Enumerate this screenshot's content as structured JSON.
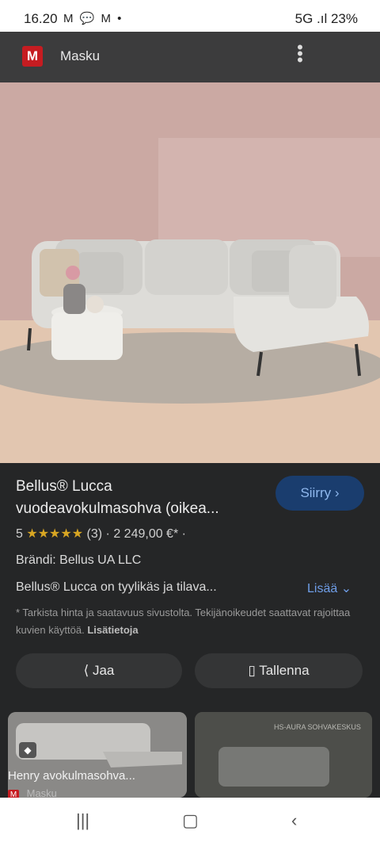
{
  "status_bar": {
    "time": "16.20",
    "left_icons": "M 💬 M •",
    "right": "5G .ıl 23%"
  },
  "app_bar": {
    "logo": "M",
    "title": "Masku"
  },
  "product": {
    "title_line1": "Bellus® Lucca",
    "title_line2": "vuodeavokulmasohva (oikea...",
    "rating_value": "5",
    "stars": "★★★★★",
    "rating_count": "(3)",
    "price": "2 249,00 €*",
    "brand": "Brändi: Bellus UA LLC",
    "description": "Bellus® Lucca on tyylikäs ja tilava...",
    "more_label": "Lisää",
    "note": "* Tarkista hinta ja saatavuus sivustolta. Tekijänoikeudet saattavat rajoittaa kuvien käyttöä.",
    "more_info": "Lisätietoja"
  },
  "actions": {
    "visit_label": "Siirry",
    "share_label": "Jaa",
    "save_label": "Tallenna"
  },
  "related": [
    {
      "title": "Henry avokulmasohva...",
      "source": "Masku"
    },
    {
      "banner": "HS-AURA SOHVAKESKUS"
    }
  ],
  "colors": {
    "wall": "#ccaaa4",
    "sofa": "#dddcd8",
    "accent": "#1a3d6e"
  }
}
